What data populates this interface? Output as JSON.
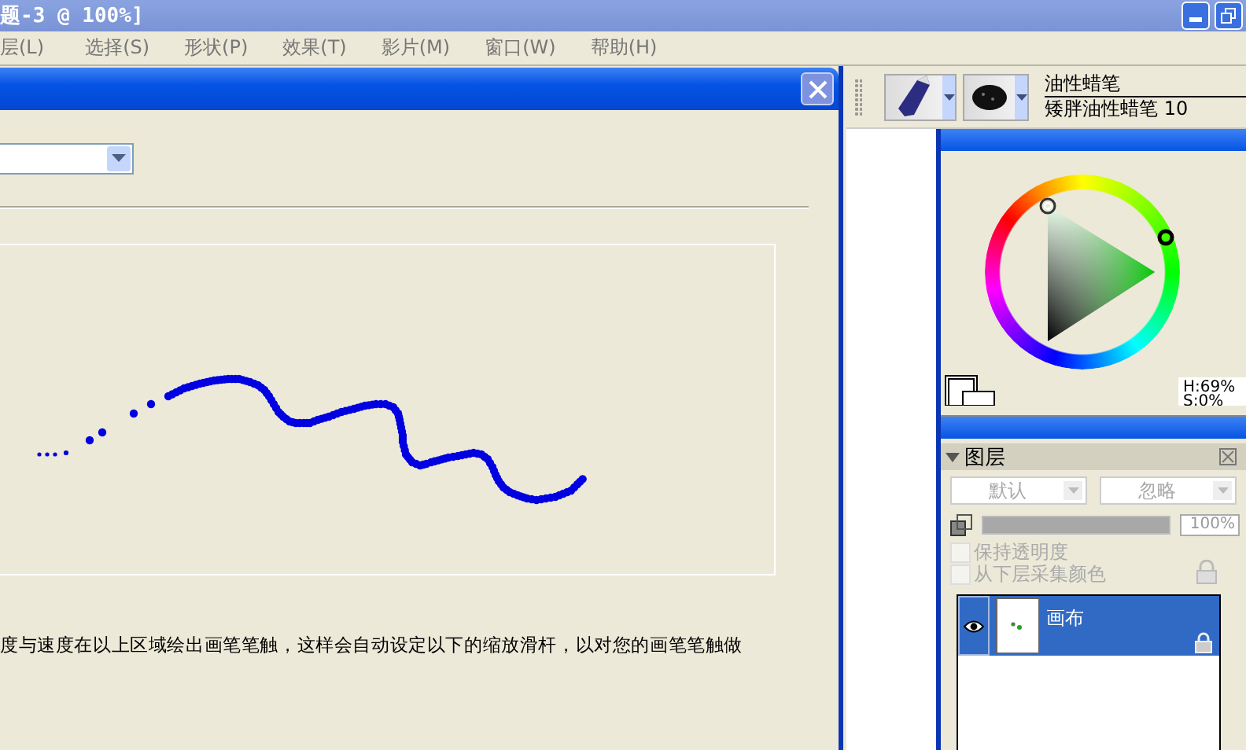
{
  "window": {
    "title": "题-3 @ 100%]"
  },
  "menu": [
    {
      "label": "层(L)"
    },
    {
      "label": "选择(S)"
    },
    {
      "label": "形状(P)"
    },
    {
      "label": "效果(T)"
    },
    {
      "label": "影片(M)"
    },
    {
      "label": "窗口(W)"
    },
    {
      "label": "帮助(H)"
    }
  ],
  "dialog": {
    "instruction": "度与速度在以上区域绘出画笔笔触，这样会自动设定以下的缩放滑杆，以对您的画笔笔触做"
  },
  "brush": {
    "category": "油性蜡笔",
    "variant": "矮胖油性蜡笔 10"
  },
  "color": {
    "hue": "H:69%",
    "saturation": "S:0%"
  },
  "layers": {
    "title": "图层",
    "composite_method": "默认",
    "composite_depth": "忽略",
    "opacity": {
      "level": 1,
      "reading": "100%"
    },
    "options": [
      {
        "label": "保持透明度",
        "checked": false,
        "disabled": true
      },
      {
        "label": "从下层采集颜色",
        "checked": false,
        "disabled": true
      }
    ],
    "items": [
      {
        "name": "画布",
        "visible": true,
        "selected": true,
        "locked": true
      }
    ]
  }
}
